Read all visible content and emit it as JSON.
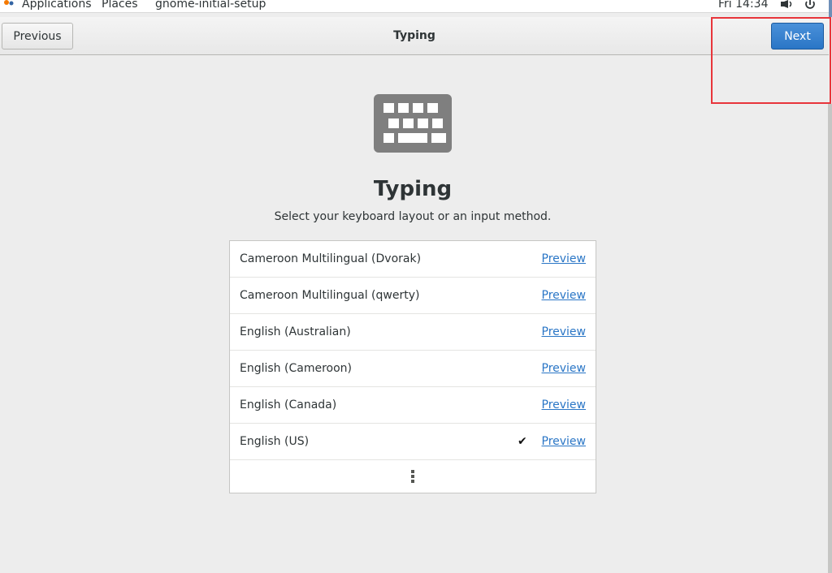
{
  "top_panel": {
    "applications": "Applications",
    "places": "Places",
    "app_name": "gnome-initial-setup",
    "clock": "Fri 14:34"
  },
  "header": {
    "previous_label": "Previous",
    "title": "Typing",
    "next_label": "Next"
  },
  "page": {
    "title": "Typing",
    "subtitle": "Select your keyboard layout or an input method."
  },
  "layouts": [
    {
      "name": "Cameroon Multilingual (Dvorak)",
      "preview": "Preview",
      "selected": false
    },
    {
      "name": "Cameroon Multilingual (qwerty)",
      "preview": "Preview",
      "selected": false
    },
    {
      "name": "English (Australian)",
      "preview": "Preview",
      "selected": false
    },
    {
      "name": "English (Cameroon)",
      "preview": "Preview",
      "selected": false
    },
    {
      "name": "English (Canada)",
      "preview": "Preview",
      "selected": false
    },
    {
      "name": "English (US)",
      "preview": "Preview",
      "selected": true,
      "check": "✔"
    }
  ],
  "icons": {
    "hero": "keyboard-icon",
    "more": "more-vertical-icon",
    "volume": "volume-icon",
    "power": "power-icon"
  },
  "colors": {
    "accent": "#2a76c6",
    "highlight": "#e8353b",
    "background": "#ededed"
  }
}
